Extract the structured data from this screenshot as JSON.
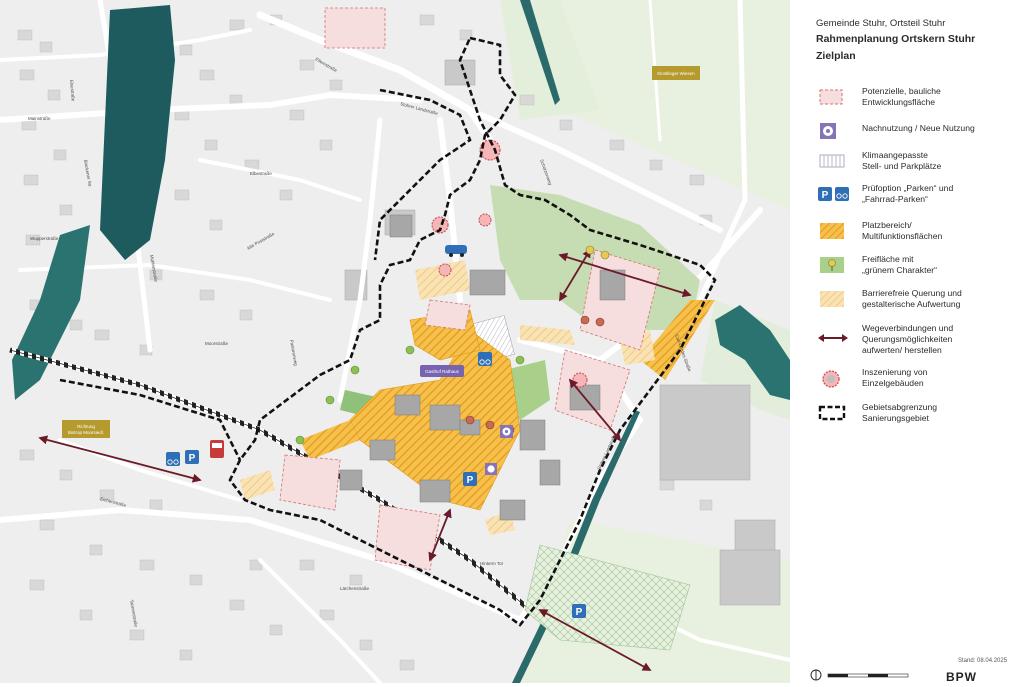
{
  "header": {
    "municipality": "Gemeinde Stuhr, Ortsteil Stuhr",
    "plan_title": "Rahmenplanung Ortskern Stuhr",
    "plan_subtitle": "Zielplan"
  },
  "legend": {
    "items": [
      {
        "id": "potential",
        "lines": [
          "Potenzielle, bauliche",
          "Entwicklungsfläche"
        ]
      },
      {
        "id": "nachnutzung",
        "lines": [
          "Nachnutzung / Neue Nutzung"
        ]
      },
      {
        "id": "klima",
        "lines": [
          "Klimaangepasste",
          "Stell- und Parkplätze"
        ]
      },
      {
        "id": "parken",
        "lines": [
          "Prüfoption „Parken“ und",
          "„Fahrrad-Parken“"
        ]
      },
      {
        "id": "platz",
        "lines": [
          "Platzbereich/",
          "Multifunktionsflächen"
        ]
      },
      {
        "id": "frei",
        "lines": [
          "Freifläche mit",
          "„grünem Charakter“"
        ]
      },
      {
        "id": "barriere",
        "lines": [
          "Barrierefreie Querung und",
          "gestalterische Aufwertung"
        ]
      },
      {
        "id": "wege",
        "lines": [
          "Wegeverbindungen und",
          "Querungsmöglichkeiten",
          "aufwerten/ herstellen"
        ]
      },
      {
        "id": "inszenierung",
        "lines": [
          "Inszenierung von",
          "Einzelgebäuden"
        ]
      },
      {
        "id": "gebiet",
        "lines": [
          "Gebietsabgrenzung",
          "Sanierungsgebiet"
        ]
      }
    ]
  },
  "footer": {
    "stand": "Stand: 08.04.2025",
    "logo": "BPW"
  },
  "map": {
    "callouts": {
      "klosterwiesen": "Klostlinger Wiesen",
      "richtung": "Richtung",
      "richtung_line2": "Bistrop Moorsiedl.",
      "guest": "Gasthof Rathaus"
    },
    "streets": {
      "s1": "Elsestraße",
      "s2": "Mainstraße",
      "s3": "Blockener Str.",
      "s4": "Wupperstraße",
      "s5": "Elbestraße",
      "s6": "Mühlenstraße",
      "s7": "Ellernstraße",
      "s8": "Stuhrer Landstraße",
      "s9": "Schützenweg",
      "s10": "Carl-Cordes-Straße",
      "s11": "Lärchenstraße",
      "s12": "Tannenstraße",
      "s13": "Eichenstraße",
      "s14": "Hinterm Tor",
      "s15": "Moorstraße",
      "s16": "Alte Poststraße",
      "s17": "Pastorenweg",
      "s18": "Stuhrer Landstraße"
    },
    "poi": {
      "parking_symbol": "P",
      "parking_symbol_2": "P",
      "parking_symbol_3": "P",
      "parking_symbol_4": "P"
    }
  }
}
